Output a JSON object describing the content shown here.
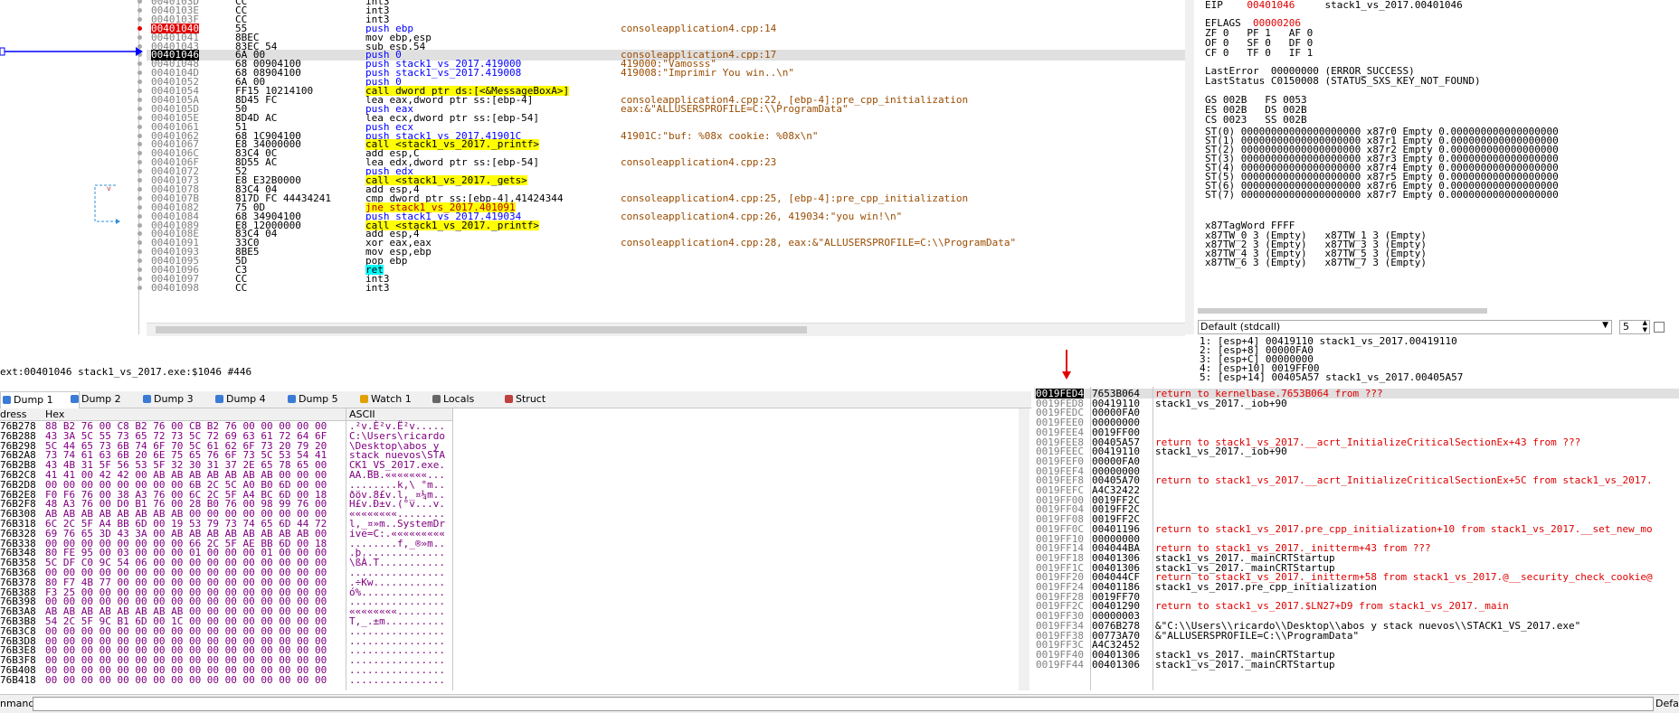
{
  "disasm": {
    "rows": [
      {
        "addr": "0040103D",
        "bytes": "CC",
        "instr": "int3",
        "cmt": ""
      },
      {
        "addr": "0040103E",
        "bytes": "CC",
        "instr": "int3",
        "cmt": ""
      },
      {
        "addr": "0040103F",
        "bytes": "CC",
        "instr": "int3",
        "cmt": ""
      },
      {
        "addr": "00401040",
        "bytes": "55",
        "instr": "push ebp",
        "cmt": "consoleapplication4.cpp:14",
        "bp": true
      },
      {
        "addr": "00401041",
        "bytes": "8BEC",
        "instr": "mov ebp,esp",
        "cmt": ""
      },
      {
        "addr": "00401043",
        "bytes": "83EC 54",
        "instr": "sub esp,54",
        "cmt": ""
      },
      {
        "addr": "00401046",
        "bytes": "6A 00",
        "instr": "push 0",
        "cmt": "consoleapplication4.cpp:17",
        "sel": true
      },
      {
        "addr": "00401048",
        "bytes": "68 00904100",
        "instr": "push stack1_vs_2017.419000",
        "cmt": "419000:\"Vamosss\""
      },
      {
        "addr": "0040104D",
        "bytes": "68 08904100",
        "instr": "push stack1_vs_2017.419008",
        "cmt": "419008:\"Imprimir You win..\\n\""
      },
      {
        "addr": "00401052",
        "bytes": "6A 00",
        "instr": "push 0",
        "cmt": ""
      },
      {
        "addr": "00401054",
        "bytes": "FF15 10214100",
        "instr": "call dword ptr ds:[<&MessageBoxA>]",
        "cmt": "",
        "call": true
      },
      {
        "addr": "0040105A",
        "bytes": "8D45 FC",
        "instr": "lea eax,dword ptr ss:[ebp-4]",
        "cmt": "consoleapplication4.cpp:22, [ebp-4]:pre_cpp_initialization"
      },
      {
        "addr": "0040105D",
        "bytes": "50",
        "instr": "push eax",
        "cmt": "eax:&\"ALLUSERSPROFILE=C:\\\\ProgramData\""
      },
      {
        "addr": "0040105E",
        "bytes": "8D4D AC",
        "instr": "lea ecx,dword ptr ss:[ebp-54]",
        "cmt": ""
      },
      {
        "addr": "00401061",
        "bytes": "51",
        "instr": "push ecx",
        "cmt": ""
      },
      {
        "addr": "00401062",
        "bytes": "68 1C904100",
        "instr": "push stack1_vs_2017.41901C",
        "cmt": "41901C:\"buf: %08x cookie: %08x\\n\""
      },
      {
        "addr": "00401067",
        "bytes": "E8 34000000",
        "instr": "call <stack1_vs_2017._printf>",
        "cmt": "",
        "call": true
      },
      {
        "addr": "0040106C",
        "bytes": "83C4 0C",
        "instr": "add esp,C",
        "cmt": ""
      },
      {
        "addr": "0040106F",
        "bytes": "8D55 AC",
        "instr": "lea edx,dword ptr ss:[ebp-54]",
        "cmt": "consoleapplication4.cpp:23"
      },
      {
        "addr": "00401072",
        "bytes": "52",
        "instr": "push edx",
        "cmt": ""
      },
      {
        "addr": "00401073",
        "bytes": "E8 E32B0000",
        "instr": "call <stack1_vs_2017._gets>",
        "cmt": "",
        "call": true
      },
      {
        "addr": "00401078",
        "bytes": "83C4 04",
        "instr": "add esp,4",
        "cmt": ""
      },
      {
        "addr": "0040107B",
        "bytes": "817D FC 44434241",
        "instr": "cmp dword ptr ss:[ebp-4],41424344",
        "cmt": "consoleapplication4.cpp:25, [ebp-4]:pre_cpp_initialization"
      },
      {
        "addr": "00401082",
        "bytes": "75 0D",
        "instr": "jne stack1_vs_2017.401091",
        "cmt": "",
        "jne": true
      },
      {
        "addr": "00401084",
        "bytes": "68 34904100",
        "instr": "push stack1_vs_2017.419034",
        "cmt": "consoleapplication4.cpp:26, 419034:\"you win!\\n\""
      },
      {
        "addr": "00401089",
        "bytes": "E8 12000000",
        "instr": "call <stack1_vs_2017._printf>",
        "cmt": "",
        "call": true
      },
      {
        "addr": "0040108E",
        "bytes": "83C4 04",
        "instr": "add esp,4",
        "cmt": ""
      },
      {
        "addr": "00401091",
        "bytes": "33C0",
        "instr": "xor eax,eax",
        "cmt": "consoleapplication4.cpp:28, eax:&\"ALLUSERSPROFILE=C:\\\\ProgramData\""
      },
      {
        "addr": "00401093",
        "bytes": "8BE5",
        "instr": "mov esp,ebp",
        "cmt": ""
      },
      {
        "addr": "00401095",
        "bytes": "5D",
        "instr": "pop ebp",
        "cmt": ""
      },
      {
        "addr": "00401096",
        "bytes": "C3",
        "instr": "ret",
        "cmt": "",
        "ret": true
      },
      {
        "addr": "00401097",
        "bytes": "CC",
        "instr": "int3",
        "cmt": ""
      },
      {
        "addr": "00401098",
        "bytes": "CC",
        "instr": "int3",
        "cmt": ""
      }
    ]
  },
  "registers": {
    "eip_label": "EIP",
    "eip_value": "00401046",
    "eip_sym": "stack1_vs_2017.00401046",
    "eflags_label": "EFLAGS",
    "eflags_value": "00000206",
    "flags": [
      "ZF 0   PF 1   AF 0",
      "OF 0   SF 0   DF 0",
      "CF 0   TF 0   IF 1"
    ],
    "lasterror": "LastError  00000000 (ERROR_SUCCESS)",
    "laststatus": "LastStatus C0150008 (STATUS_SXS_KEY_NOT_FOUND)",
    "segs": [
      "GS 002B   FS 0053",
      "ES 002B   DS 002B",
      "CS 0023   SS 002B"
    ],
    "fpu": [
      "ST(0) 00000000000000000000 x87r0 Empty 0.000000000000000000",
      "ST(1) 00000000000000000000 x87r1 Empty 0.000000000000000000",
      "ST(2) 00000000000000000000 x87r2 Empty 0.000000000000000000",
      "ST(3) 00000000000000000000 x87r3 Empty 0.000000000000000000",
      "ST(4) 00000000000000000000 x87r4 Empty 0.000000000000000000",
      "ST(5) 00000000000000000000 x87r5 Empty 0.000000000000000000",
      "ST(6) 00000000000000000000 x87r6 Empty 0.000000000000000000",
      "ST(7) 00000000000000000000 x87r7 Empty 0.000000000000000000"
    ],
    "tagword": "x87TagWord FFFF",
    "tw": [
      "x87TW_0 3 (Empty)   x87TW_1 3 (Empty)",
      "x87TW_2 3 (Empty)   x87TW_3 3 (Empty)",
      "x87TW_4 3 (Empty)   x87TW_5 3 (Empty)",
      "x87TW_6 3 (Empty)   x87TW_7 3 (Empty)"
    ]
  },
  "callconv": {
    "selected": "Default (stdcall)",
    "count": "5"
  },
  "stackargs": [
    "1: [esp+4] 00419110 stack1_vs_2017.00419110",
    "2: [esp+8] 00000FA0",
    "3: [esp+C] 00000000",
    "4: [esp+10] 0019FF00",
    "5: [esp+14] 00405A57 stack1_vs_2017.00405A57"
  ],
  "status": {
    "text": "ext:00401046 stack1_vs_2017.exe:$1046 #446"
  },
  "tabs": [
    {
      "label": "Dump 1",
      "active": true
    },
    {
      "label": "Dump 2"
    },
    {
      "label": "Dump 3"
    },
    {
      "label": "Dump 4"
    },
    {
      "label": "Dump 5"
    },
    {
      "label": "Watch 1"
    },
    {
      "label": "Locals"
    },
    {
      "label": "Struct"
    }
  ],
  "dump": {
    "head_addr": "dress",
    "head_hex": "Hex",
    "head_ascii": "ASCII",
    "rows": [
      {
        "a": "76B278",
        "h": "88 B2 76 00 C8 B2 76 00 CB B2 76 00 00 00 00 00",
        "s": ".²v.È²v.Ë²v....."
      },
      {
        "a": "76B288",
        "h": "43 3A 5C 55 73 65 72 73 5C 72 69 63 61 72 64 6F",
        "s": "C:\\Users\\ricardo"
      },
      {
        "a": "76B298",
        "h": "5C 44 65 73 6B 74 6F 70 5C 61 62 6F 73 20 79 20",
        "s": "\\Desktop\\abos y "
      },
      {
        "a": "76B2A8",
        "h": "73 74 61 63 6B 20 6E 75 65 76 6F 73 5C 53 54 41",
        "s": "stack nuevos\\STA"
      },
      {
        "a": "76B2B8",
        "h": "43 4B 31 5F 56 53 5F 32 30 31 37 2E 65 78 65 00",
        "s": "CK1_VS_2017.exe."
      },
      {
        "a": "76B2C8",
        "h": "41 41 00 42 42 00 AB AB AB AB AB AB AB 00 00 00",
        "s": "AA.BB.«««««««..."
      },
      {
        "a": "76B2D8",
        "h": "00 00 00 00 00 00 00 00 6B 2C 5C A0 B0 6D 00 00",
        "s": "........k,\\ °m.."
      },
      {
        "a": "76B2E8",
        "h": "F0 F6 76 00 38 A3 76 00 6C 2C 5F A4 BC 6D 00 18",
        "s": "ðöv.8£v.l,_¤¼m.."
      },
      {
        "a": "76B2F8",
        "h": "48 A3 76 00 D0 B1 76 00 28 B0 76 00 98 99 76 00",
        "s": "H£v.Ð±v.(°v...v."
      },
      {
        "a": "76B308",
        "h": "AB AB AB AB AB AB AB AB 00 00 00 00 00 00 00 00",
        "s": "««««««««........"
      },
      {
        "a": "76B318",
        "h": "6C 2C 5F A4 BB 6D 00 19 53 79 73 74 65 6D 44 72",
        "s": "l,_¤»m..SystemDr"
      },
      {
        "a": "76B328",
        "h": "69 76 65 3D 43 3A 00 AB AB AB AB AB AB AB AB 00",
        "s": "ive=C:.«««««««««"
      },
      {
        "a": "76B338",
        "h": "00 00 00 00 00 00 00 00 66 2C 5F AE BB 6D 00 18",
        "s": "........f,_®»m.."
      },
      {
        "a": "76B348",
        "h": "80 FE 95 00 03 00 00 00 01 00 00 00 01 00 00 00",
        "s": ".þ.............."
      },
      {
        "a": "76B358",
        "h": "5C DF C0 9C 54 06 00 00 00 00 00 00 00 00 00 00",
        "s": "\\ßÀ.T..........."
      },
      {
        "a": "76B368",
        "h": "00 00 00 00 00 00 00 00 00 00 00 00 00 00 00 00",
        "s": "................"
      },
      {
        "a": "76B378",
        "h": "80 F7 4B 77 00 00 00 00 00 00 00 00 00 00 00 00",
        "s": ".÷Kw............"
      },
      {
        "a": "76B388",
        "h": "F3 25 00 00 00 00 00 00 00 00 00 00 00 00 00 00",
        "s": "ó%.............."
      },
      {
        "a": "76B398",
        "h": "00 00 00 00 00 00 00 00 00 00 00 00 00 00 00 00",
        "s": "................"
      },
      {
        "a": "76B3A8",
        "h": "AB AB AB AB AB AB AB AB 00 00 00 00 00 00 00 00",
        "s": "««««««««........"
      },
      {
        "a": "76B3B8",
        "h": "54 2C 5F 9C B1 6D 00 1C 00 00 00 00 00 00 00 00",
        "s": "T,_.±m.........."
      },
      {
        "a": "76B3C8",
        "h": "00 00 00 00 00 00 00 00 00 00 00 00 00 00 00 00",
        "s": "................"
      },
      {
        "a": "76B3D8",
        "h": "00 00 00 00 00 00 00 00 00 00 00 00 00 00 00 00",
        "s": "................"
      },
      {
        "a": "76B3E8",
        "h": "00 00 00 00 00 00 00 00 00 00 00 00 00 00 00 00",
        "s": "................"
      },
      {
        "a": "76B3F8",
        "h": "00 00 00 00 00 00 00 00 00 00 00 00 00 00 00 00",
        "s": "................"
      },
      {
        "a": "76B408",
        "h": "00 00 00 00 00 00 00 00 00 00 00 00 00 00 00 00",
        "s": "................"
      },
      {
        "a": "76B418",
        "h": "00 00 00 00 00 00 00 00 00 00 00 00 00 00 00 00",
        "s": "................"
      }
    ]
  },
  "stack": {
    "rows": [
      {
        "a": "0019FED4",
        "v": "7653B064",
        "c": "return to kernelbase.7653B064 from ???",
        "ret": true,
        "top": true
      },
      {
        "a": "0019FED8",
        "v": "00419110",
        "c": "stack1_vs_2017._iob+90"
      },
      {
        "a": "0019FEDC",
        "v": "00000FA0",
        "c": ""
      },
      {
        "a": "0019FEE0",
        "v": "00000000",
        "c": ""
      },
      {
        "a": "0019FEE4",
        "v": "0019FF00",
        "c": ""
      },
      {
        "a": "0019FEE8",
        "v": "00405A57",
        "c": "return to stack1_vs_2017.__acrt_InitializeCriticalSectionEx+43 from ???",
        "ret": true
      },
      {
        "a": "0019FEEC",
        "v": "00419110",
        "c": "stack1_vs_2017._iob+90"
      },
      {
        "a": "0019FEF0",
        "v": "00000FA0",
        "c": ""
      },
      {
        "a": "0019FEF4",
        "v": "00000000",
        "c": ""
      },
      {
        "a": "0019FEF8",
        "v": "00405A70",
        "c": "return to stack1_vs_2017.__acrt_InitializeCriticalSectionEx+5C from stack1_vs_2017.",
        "ret": true
      },
      {
        "a": "0019FEFC",
        "v": "A4C32422",
        "c": ""
      },
      {
        "a": "0019FF00",
        "v": "0019FF2C",
        "c": ""
      },
      {
        "a": "0019FF04",
        "v": "0019FF2C",
        "c": ""
      },
      {
        "a": "0019FF08",
        "v": "0019FF2C",
        "c": ""
      },
      {
        "a": "0019FF0C",
        "v": "00401196",
        "c": "return to stack1_vs_2017.pre_cpp_initialization+10 from stack1_vs_2017.__set_new_mo",
        "ret": true
      },
      {
        "a": "0019FF10",
        "v": "00000000",
        "c": ""
      },
      {
        "a": "0019FF14",
        "v": "004044BA",
        "c": "return to stack1_vs_2017._initterm+43 from ???",
        "ret": true
      },
      {
        "a": "0019FF18",
        "v": "00401306",
        "c": "stack1_vs_2017._mainCRTStartup"
      },
      {
        "a": "0019FF1C",
        "v": "00401306",
        "c": "stack1_vs_2017._mainCRTStartup"
      },
      {
        "a": "0019FF20",
        "v": "004044CF",
        "c": "return to stack1_vs_2017._initterm+58 from stack1_vs_2017.@__security_check_cookie@",
        "ret": true
      },
      {
        "a": "0019FF24",
        "v": "00401186",
        "c": "stack1_vs_2017.pre_cpp_initialization"
      },
      {
        "a": "0019FF28",
        "v": "0019FF70",
        "c": ""
      },
      {
        "a": "0019FF2C",
        "v": "00401290",
        "c": "return to stack1_vs_2017.$LN27+D9 from stack1_vs_2017._main",
        "ret": true
      },
      {
        "a": "0019FF30",
        "v": "00000003",
        "c": ""
      },
      {
        "a": "0019FF34",
        "v": "0076B278",
        "c": "&\"C:\\\\Users\\\\ricardo\\\\Desktop\\\\abos y stack nuevos\\\\STACK1_VS_2017.exe\""
      },
      {
        "a": "0019FF38",
        "v": "00773A70",
        "c": "&\"ALLUSERSPROFILE=C:\\\\ProgramData\""
      },
      {
        "a": "0019FF3C",
        "v": "A4C32452",
        "c": ""
      },
      {
        "a": "0019FF40",
        "v": "00401306",
        "c": "stack1_vs_2017._mainCRTStartup"
      },
      {
        "a": "0019FF44",
        "v": "00401306",
        "c": "stack1_vs_2017._mainCRTStartup"
      }
    ]
  },
  "command": {
    "label": "nmand:",
    "default": "Defau"
  },
  "colors": {
    "accent": "#0000ff",
    "breakpoint": "#e00000",
    "call": "#ffff00",
    "ret": "#00ffff"
  }
}
